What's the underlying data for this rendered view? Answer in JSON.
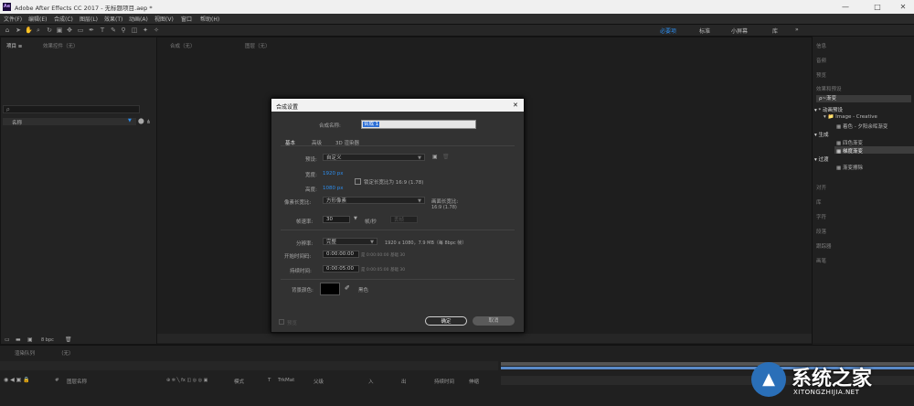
{
  "window": {
    "title": "Adobe After Effects CC 2017 - 无标题项目.aep *",
    "logo": "Ae",
    "minimize": "—",
    "maximize": "□",
    "close": "✕"
  },
  "menu": [
    "文件(F)",
    "编辑(E)",
    "合成(C)",
    "图层(L)",
    "效果(T)",
    "动画(A)",
    "视图(V)",
    "窗口",
    "帮助(H)"
  ],
  "workspace": {
    "tabs": [
      "必要项",
      "标准",
      "小屏幕",
      "库"
    ],
    "active_tab": "必要项",
    "more": "»"
  },
  "project_panel": {
    "tab_project": "项目 ≡",
    "tab_effect_controls": "效果控件（无）",
    "search_placeholder": "ρ",
    "column_name": "名称",
    "bpc": "8 bpc"
  },
  "comp_panel": {
    "tab_composition": "合成（无）",
    "tab_layer": "图层（无）"
  },
  "dialog": {
    "title": "合成设置",
    "close": "✕",
    "comp_name_label": "合成名称:",
    "comp_name_value": "合成 1",
    "tabs": [
      "基本",
      "高级",
      "3D 渲染器"
    ],
    "preset_label": "预设:",
    "preset_value": "自定义",
    "width_label": "宽度:",
    "width_value": "1920 px",
    "height_label": "高度:",
    "height_value": "1080 px",
    "lock_aspect_label": "锁定长宽比为 16:9 (1.78)",
    "pixel_aspect_label": "像素长宽比:",
    "pixel_aspect_value": "方形像素",
    "frame_aspect_label": "画面长宽比:",
    "frame_aspect_value": "16:9 (1.78)",
    "frame_rate_label": "帧速率:",
    "frame_rate_value": "30",
    "frame_rate_unit": "帧/秒",
    "frame_rate_drop": "丢帧",
    "resolution_label": "分辨率:",
    "resolution_value": "完整",
    "resolution_info": "1920 x 1080，7.9 MB（每 8bpc 帧）",
    "start_tc_label": "开始时间码:",
    "start_tc_value": "0:00:00:00",
    "start_tc_info": "是 0:00:00:00  基础 30",
    "duration_label": "持续时间:",
    "duration_value": "0:00:05:00",
    "duration_info": "是 0:00:05:00  基础 30",
    "bg_color_label": "背景颜色:",
    "bg_color_name": "黑色",
    "preview_label": "预览",
    "ok": "确定",
    "cancel": "取消",
    "colors": {
      "bg_swatch": "#000000",
      "accent": "#2d8ceb"
    }
  },
  "right_panel": {
    "items_top": [
      "信息",
      "音频",
      "预览"
    ],
    "effects_presets": "效果和预设",
    "search_value": "ρ~渐变",
    "tree": [
      {
        "text": "▾ * 动画预设",
        "indent": 0
      },
      {
        "text": "▾ 📁 Image - Creative",
        "indent": 1
      },
      {
        "text": "▦ 着色 - 夕阳余晖渐变",
        "indent": 2
      },
      {
        "text": "▾ 生成",
        "indent": 0
      },
      {
        "text": "▦ 四色渐变",
        "indent": 2
      },
      {
        "text": "▦ 梯度渐变",
        "indent": 2
      },
      {
        "text": "▾ 过渡",
        "indent": 0
      },
      {
        "text": "▦ 渐变擦除",
        "indent": 2
      }
    ],
    "items_bottom": [
      "对齐",
      "库",
      "字符",
      "段落",
      "跟踪器",
      "画笔"
    ]
  },
  "timeline": {
    "tab": "渲染队列",
    "comp_tab": "（无）",
    "columns": [
      "图层名称",
      "模式",
      "T",
      "TrkMat",
      "父级",
      "入",
      "出",
      "持续时间",
      "伸缩"
    ]
  },
  "watermark": {
    "text": "系统之家",
    "url": "XITONGZHIJIA.NET"
  }
}
